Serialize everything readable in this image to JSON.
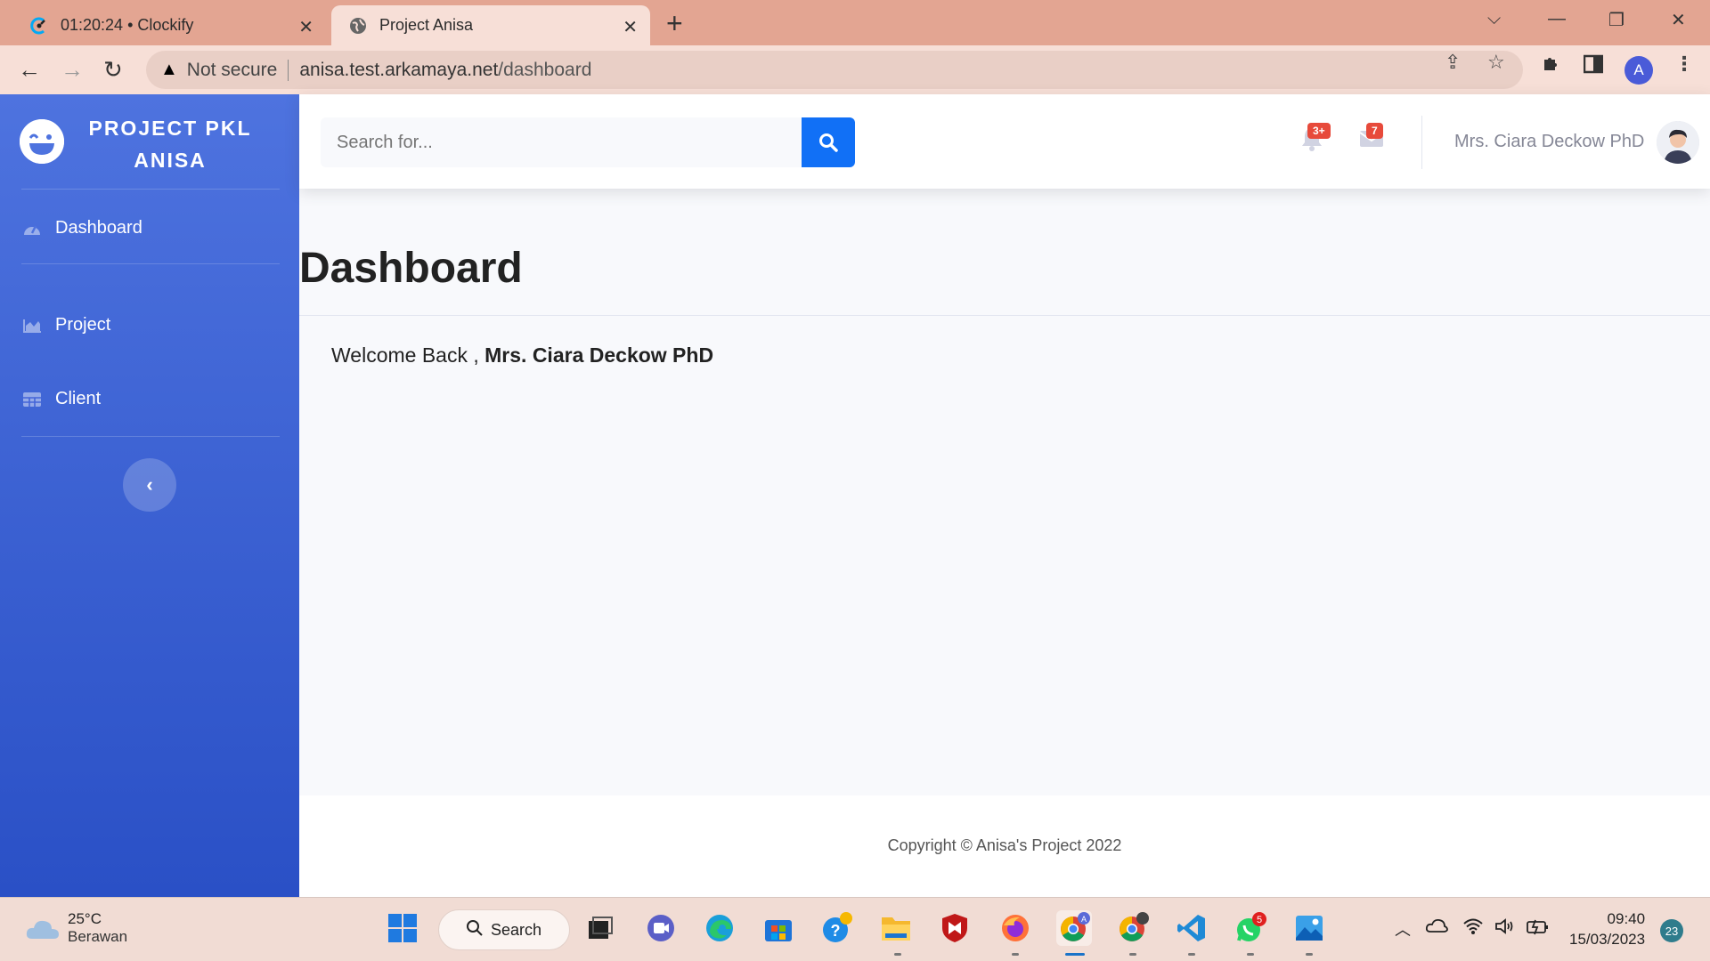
{
  "browser": {
    "tabs": [
      {
        "title": "01:20:24 • Clockify",
        "icon": "clockify-icon"
      },
      {
        "title": "Project Anisa",
        "icon": "globe-icon",
        "active": true
      }
    ],
    "security_label": "Not secure",
    "url_host": "anisa.test.arkamaya.net",
    "url_path": "/dashboard",
    "profile_initial": "A"
  },
  "sidebar": {
    "brand_line1": "PROJECT PKL",
    "brand_line2": "ANISA",
    "items": [
      {
        "label": "Dashboard",
        "icon": "tachometer-icon"
      },
      {
        "label": "Project",
        "icon": "chart-area-icon"
      },
      {
        "label": "Client",
        "icon": "table-icon"
      }
    ],
    "toggle_icon": "chevron-left-icon"
  },
  "topbar": {
    "search_placeholder": "Search for...",
    "alerts_badge": "3+",
    "messages_badge": "7",
    "user_name": "Mrs. Ciara Deckow PhD"
  },
  "main": {
    "page_title": "Dashboard",
    "welcome_prefix": "Welcome Back ,",
    "welcome_name": "Mrs. Ciara Deckow PhD"
  },
  "footer": {
    "copyright": "Copyright © Anisa's Project 2022"
  },
  "taskbar": {
    "weather_temp": "25°C",
    "weather_desc": "Berawan",
    "search_label": "Search",
    "whatsapp_badge": "5",
    "time": "09:40",
    "date": "15/03/2023",
    "notification_count": "23"
  },
  "colors": {
    "sidebar_top": "#4e73df",
    "sidebar_bottom": "#2a50c6",
    "primary": "#1170f6",
    "danger": "#e74a3b",
    "chrome_tab": "#e3a592"
  }
}
